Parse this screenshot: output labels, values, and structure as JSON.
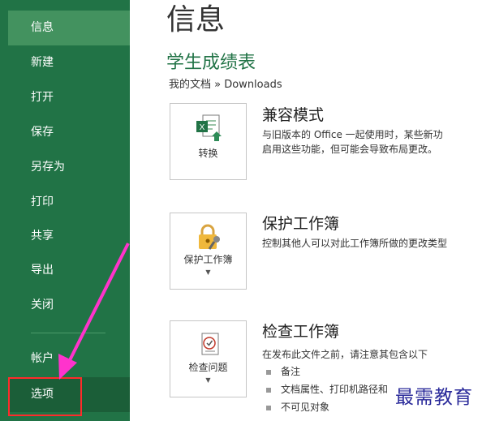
{
  "sidebar": {
    "items": [
      {
        "label": "信息"
      },
      {
        "label": "新建"
      },
      {
        "label": "打开"
      },
      {
        "label": "保存"
      },
      {
        "label": "另存为"
      },
      {
        "label": "打印"
      },
      {
        "label": "共享"
      },
      {
        "label": "导出"
      },
      {
        "label": "关闭"
      },
      {
        "label": "帐户"
      },
      {
        "label": "选项"
      }
    ]
  },
  "main": {
    "page_title": "信息",
    "doc_title": "学生成绩表",
    "breadcrumb": "我的文档 » Downloads",
    "sections": [
      {
        "button_label": "转换",
        "title": "兼容模式",
        "desc_lines": [
          "与旧版本的 Office 一起使用时，某些新功",
          "启用这些功能，但可能会导致布局更改。"
        ]
      },
      {
        "button_label": "保护工作簿",
        "title": "保护工作簿",
        "desc_lines": [
          "控制其他人可以对此工作簿所做的更改类型"
        ]
      },
      {
        "button_label": "检查问题",
        "title": "检查工作簿",
        "desc_lines": [
          "在发布此文件之前，请注意其包含以下"
        ],
        "bullets": [
          "备注",
          "文档属性、打印机路径和",
          "不可见对象"
        ]
      }
    ]
  },
  "watermark": "最需教育",
  "colors": {
    "sidebar": "#217346",
    "active": "#43925f",
    "annotation": "#ff2b2b",
    "arrow": "#ff33cc"
  }
}
